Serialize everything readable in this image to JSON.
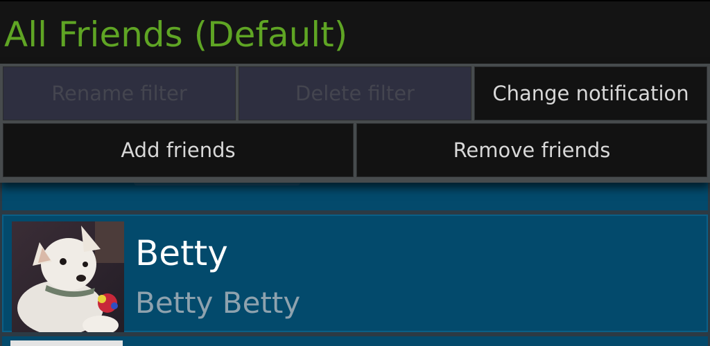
{
  "header": {
    "title": "All Friends (Default)"
  },
  "menu": {
    "rename_filter": "Rename filter",
    "delete_filter": "Delete filter",
    "change_notification": "Change notification",
    "add_friends": "Add friends",
    "remove_friends": "Remove friends"
  },
  "friends": [
    {
      "name": "Betty",
      "full_name": "Betty Betty",
      "avatar": "puppy-photo"
    }
  ],
  "colors": {
    "title_green": "#5fa524",
    "list_blue": "#034a6c",
    "disabled_button": "#2e2f40"
  }
}
